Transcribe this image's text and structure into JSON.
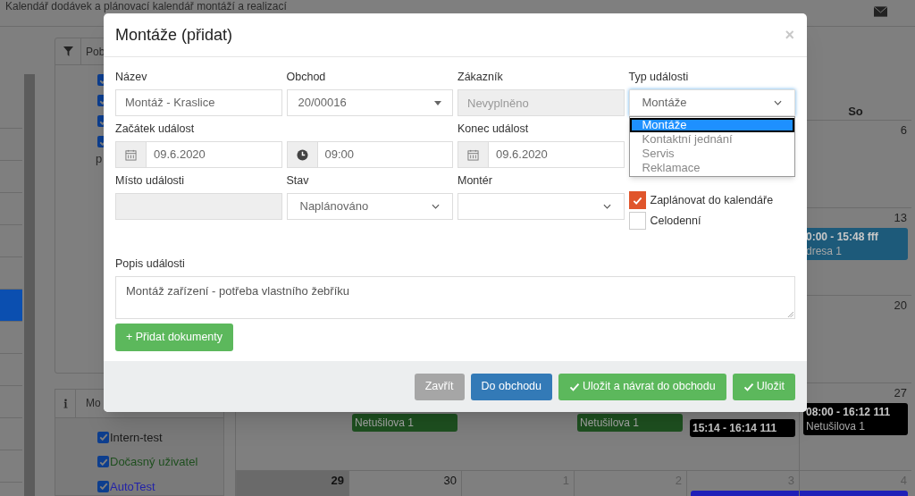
{
  "page": {
    "title": "Kalendář dodávek a plánovací kalendář montáží a realizací"
  },
  "sidebar": {
    "items": [
      {
        "selected": false
      },
      {
        "selected": false
      },
      {
        "selected": false
      },
      {
        "selected": false
      },
      {
        "selected": false
      },
      {
        "selected": false
      },
      {
        "selected": true
      },
      {
        "selected": false
      },
      {
        "selected": false
      },
      {
        "selected": false
      },
      {
        "selected": false
      },
      {
        "selected": false
      }
    ]
  },
  "filter_panel": {
    "heading": "Pob",
    "checks": [
      {
        "checked": true
      },
      {
        "checked": true
      },
      {
        "checked": true
      },
      {
        "checked": true
      }
    ],
    "note": "p"
  },
  "users_panel": {
    "heading": "Mo",
    "users": [
      {
        "label": "Intern-test",
        "checked": true,
        "color": "#1a1a1a"
      },
      {
        "label": "Dočasný uživatel",
        "checked": true,
        "color": "#1f4f1f"
      },
      {
        "label": "AutoTest",
        "checked": true,
        "color": "#2323a8"
      }
    ]
  },
  "calendar": {
    "weekday": "So",
    "saturdays": [
      {
        "day": "6"
      },
      {
        "day": "13",
        "events": [
          {
            "time": "0:00 - 15:48 fff",
            "place": "dresa 1",
            "color": "#1d5a7a"
          }
        ]
      },
      {
        "day": "20"
      },
      {
        "day": "27",
        "events": [
          {
            "time": "08:00 - 16:12 111",
            "place": "Netušilova 1",
            "color": "#000000"
          }
        ]
      }
    ],
    "week4_cells": [
      {
        "kind": "empty"
      },
      {
        "kind": "events",
        "events": [
          {
            "place": "Netušilova 1",
            "color": "#1e5020"
          }
        ]
      },
      {
        "kind": "empty"
      },
      {
        "kind": "events",
        "events": [
          {
            "place": "Netušilova 1",
            "color": "#1e5020"
          }
        ]
      },
      {
        "kind": "events",
        "events": [
          {
            "time": "15:14 - 16:14 111",
            "color": "#000000"
          }
        ]
      }
    ],
    "last_week": [
      {
        "day": "29",
        "today": true,
        "other_month": false
      },
      {
        "day": "30",
        "today": false,
        "other_month": false
      },
      {
        "day": "1",
        "today": false,
        "other_month": true
      },
      {
        "day": "2",
        "today": false,
        "other_month": true
      },
      {
        "day": "3",
        "today": false,
        "other_month": true
      },
      {
        "day": "4",
        "today": false,
        "other_month": true
      }
    ],
    "last_week_bar": {
      "color": "#2020b8"
    }
  },
  "dialog": {
    "title": "Montáže (přidat)",
    "close": "×",
    "rows": [
      [
        {
          "kind": "text",
          "label": "Název",
          "value": "Montáž - Kraslice"
        },
        {
          "kind": "combo",
          "label": "Obchod",
          "value": "20/00016"
        },
        {
          "kind": "disabled",
          "label": "Zákazník",
          "placeholder": "Nevyplněno"
        },
        {
          "kind": "select",
          "label": "Typ události",
          "value": "Montáže",
          "focused": true,
          "options": [
            {
              "label": "Montáže",
              "selected": true
            },
            {
              "label": "Kontaktní jednání",
              "selected": false
            },
            {
              "label": "Servis",
              "selected": false
            },
            {
              "label": "Reklamace",
              "selected": false
            }
          ]
        }
      ],
      [
        {
          "kind": "date",
          "label": "Začátek událost",
          "value": "09.6.2020"
        },
        {
          "kind": "time",
          "value": "09:00"
        },
        {
          "kind": "date",
          "label": "Konec událost",
          "value": "09.6.2020"
        }
      ],
      [
        {
          "kind": "disabled",
          "label": "Místo události"
        },
        {
          "kind": "select",
          "label": "Stav",
          "value": "Naplánováno",
          "focused": false
        },
        {
          "kind": "select",
          "label": "Montér",
          "focused": false
        },
        {
          "kind": "checks",
          "items": [
            {
              "label": "Zaplánovat do kalendáře",
              "checked": true
            },
            {
              "label": "Celodenní",
              "checked": false
            }
          ]
        }
      ]
    ],
    "description": {
      "label": "Popis události",
      "value": "Montáž zařízení - potřeba vlastního žebříku"
    },
    "add_button": "+ Přidat dokumenty",
    "buttons": [
      {
        "kind": "default",
        "label": "Zavřít"
      },
      {
        "kind": "primary",
        "label": "Do obchodu"
      },
      {
        "kind": "success",
        "label": "Uložit a návrat do obchodu"
      },
      {
        "kind": "success",
        "label": "Uložit"
      }
    ]
  }
}
